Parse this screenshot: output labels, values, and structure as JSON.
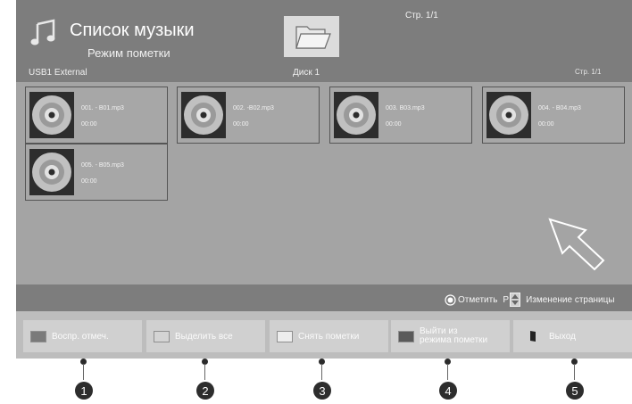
{
  "header": {
    "page_top": "Стр. 1/1",
    "title": "Список музыки",
    "subtitle": "Режим пометки",
    "device": "USB1 External",
    "folder_icon": "folder-icon",
    "disk_label": "Диск 1",
    "page_right": "Стр. 1/1"
  },
  "files": [
    {
      "name": "001. - B01.mp3",
      "time": "00:00"
    },
    {
      "name": "002. -B02.mp3",
      "time": "00:00"
    },
    {
      "name": "003. B03.mp3",
      "time": "00:00"
    },
    {
      "name": "004. - B04.mp3",
      "time": "00:00"
    },
    {
      "name": "005. - B05.mp3",
      "time": "00:00"
    }
  ],
  "legend": {
    "mark": "Отметить",
    "page_prefix": "P",
    "page_change": "Изменение страницы"
  },
  "buttons": [
    {
      "label": "Воспр. отмеч.",
      "color": "#7a7a7a"
    },
    {
      "label": "Выделить все",
      "color": "#d4d4d4"
    },
    {
      "label": "Снять пометки",
      "color": "#ededed"
    },
    {
      "label_line1": "Выйти из",
      "label_line2": "режима пометки",
      "color": "#5a5a5a"
    },
    {
      "label": "Выход",
      "icon": "exit-icon"
    }
  ],
  "callouts": [
    "1",
    "2",
    "3",
    "4",
    "5"
  ],
  "colors": {
    "background": "#7d7d7d",
    "grid": "#a4a4a4",
    "button_bar": "#bdbdbd",
    "button": "#d0d0d0"
  }
}
